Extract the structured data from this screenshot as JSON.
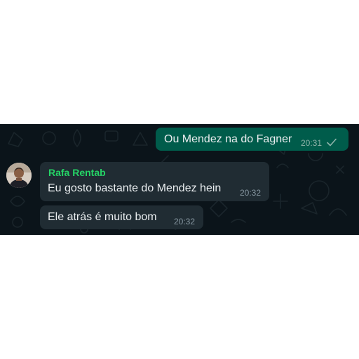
{
  "conversation": {
    "messages": [
      {
        "direction": "outgoing",
        "text": "Ou Mendez na do Fagner",
        "time": "20:31",
        "status_icon": "single-check-icon"
      },
      {
        "direction": "incoming",
        "sender": "Rafa Rentab",
        "text": "Eu gosto bastante do Mendez hein",
        "time": "20:32"
      },
      {
        "direction": "incoming",
        "text": "Ele atrás é muito bom",
        "time": "20:32"
      }
    ]
  },
  "colors": {
    "chat_background": "#0b141a",
    "outgoing_bubble": "#005c4b",
    "incoming_bubble": "#202c33",
    "sender_name": "#25d366",
    "message_text": "#e9edef"
  }
}
